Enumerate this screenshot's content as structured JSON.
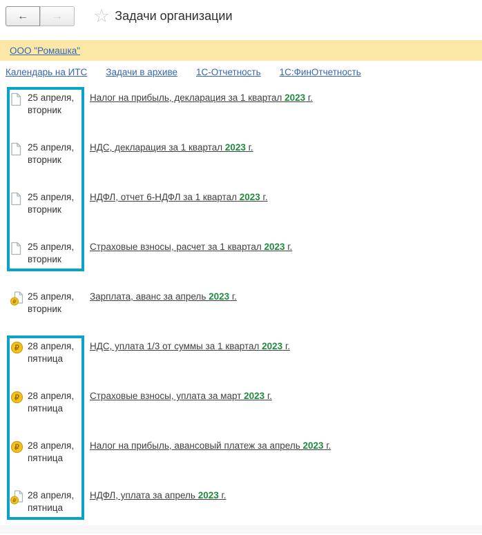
{
  "toolbar": {
    "back_label": "←",
    "forward_label": "→",
    "favorite_star": "☆",
    "title": "Задачи организации"
  },
  "org_bar": {
    "link_label": "ООО \"Ромашка\""
  },
  "nav_links": [
    {
      "label": "Календарь на ИТС"
    },
    {
      "label": "Задачи в архиве"
    },
    {
      "label": "1С-Отчетность"
    },
    {
      "label": "1С:ФинОтчетность"
    }
  ],
  "tasks": [
    {
      "icon": "document-icon",
      "date_line1": "25 апреля,",
      "date_line2": "вторник",
      "title_prefix": "Налог на прибыль, декларация за 1 квартал ",
      "year": "2023",
      "title_suffix": " г.",
      "selected": true
    },
    {
      "icon": "document-icon",
      "date_line1": "25 апреля,",
      "date_line2": "вторник",
      "title_prefix": "НДС, декларация за 1 квартал ",
      "year": "2023",
      "title_suffix": " г.",
      "selected": true
    },
    {
      "icon": "document-icon",
      "date_line1": "25 апреля,",
      "date_line2": "вторник",
      "title_prefix": "НДФЛ, отчет 6-НДФЛ за 1 квартал ",
      "year": "2023",
      "title_suffix": " г.",
      "selected": true
    },
    {
      "icon": "document-icon",
      "date_line1": "25 апреля,",
      "date_line2": "вторник",
      "title_prefix": "Страховые взносы, расчет за 1 квартал ",
      "year": "2023",
      "title_suffix": " г.",
      "selected": true
    },
    {
      "icon": "document-ruble-icon",
      "date_line1": "25 апреля,",
      "date_line2": "вторник",
      "title_prefix": "Зарплата, аванс за апрель ",
      "year": "2023",
      "title_suffix": " г.",
      "selected": false
    },
    {
      "icon": "ruble-coin-icon",
      "date_line1": "28 апреля,",
      "date_line2": "пятница",
      "title_prefix": "НДС, уплата 1/3 от суммы за 1 квартал ",
      "year": "2023",
      "title_suffix": " г.",
      "selected": true
    },
    {
      "icon": "ruble-coin-icon",
      "date_line1": "28 апреля,",
      "date_line2": "пятница",
      "title_prefix": "Страховые взносы, уплата за март ",
      "year": "2023",
      "title_suffix": " г.",
      "selected": true
    },
    {
      "icon": "ruble-coin-icon",
      "date_line1": "28 апреля,",
      "date_line2": "пятница",
      "title_prefix": "Налог на прибыль, авансовый платеж за апрель ",
      "year": "2023",
      "title_suffix": " г.",
      "selected": true
    },
    {
      "icon": "document-ruble-icon",
      "date_line1": "28 апреля,",
      "date_line2": "пятница",
      "title_prefix": "НДФЛ, уплата за апрель ",
      "year": "2023",
      "title_suffix": " г.",
      "selected": true
    }
  ],
  "colors": {
    "selection_teal": "#0aa2c5",
    "org_bar_yellow": "#fbe8a6",
    "link_blue": "#3566b5",
    "year_green": "#1d8a3c",
    "coin_gold": "#f6c21c"
  }
}
